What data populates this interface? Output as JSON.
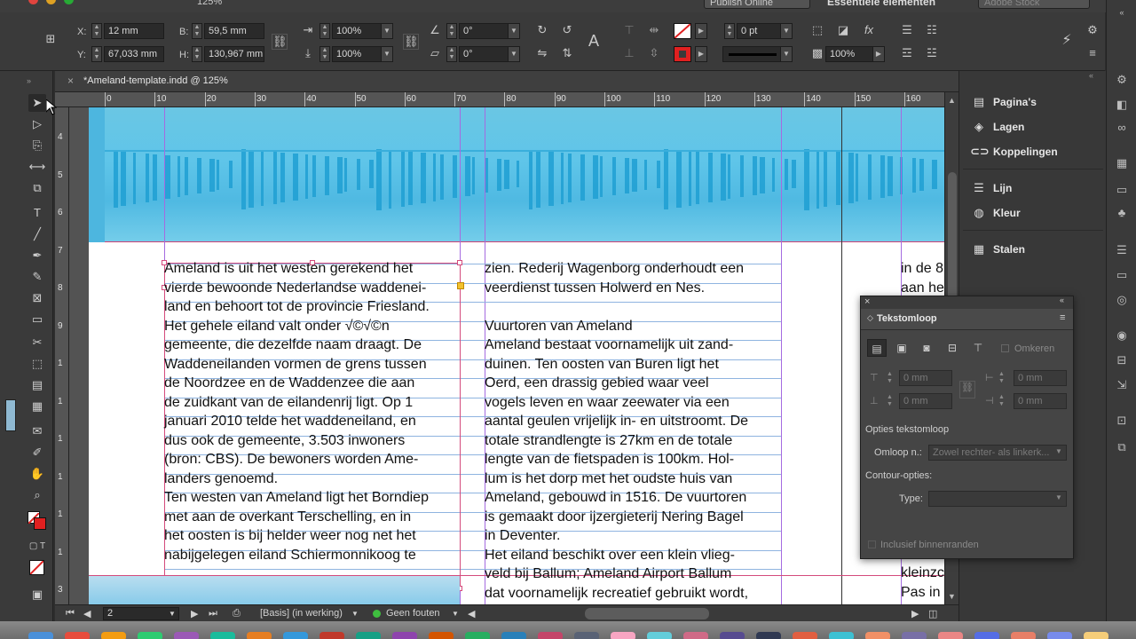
{
  "topbar": {
    "zoom": "125%",
    "publish_label": "Publish Online",
    "workspace_label": "Essentiële elementen",
    "search_placeholder": "Adobe Stock"
  },
  "control": {
    "x_label": "X:",
    "x_value": "12 mm",
    "y_label": "Y:",
    "y_value": "67,033 mm",
    "w_label": "B:",
    "w_value": "59,5 mm",
    "h_label": "H:",
    "h_value": "130,967 mm",
    "scale_x": "100%",
    "scale_y": "100%",
    "rotate": "0°",
    "shear": "0°",
    "stroke_weight": "0 pt",
    "opacity": "100%"
  },
  "tools": [
    "selection-tool",
    "direct-selection-tool",
    "page-tool",
    "gap-tool",
    "content-collector-tool",
    "type-tool",
    "line-tool",
    "pen-tool",
    "pencil-tool",
    "rectangle-frame-tool",
    "rectangle-tool",
    "scissors-tool",
    "free-transform-tool",
    "gradient-swatch-tool",
    "gradient-feather-tool",
    "note-tool",
    "eyedropper-tool",
    "hand-tool",
    "zoom-tool"
  ],
  "document": {
    "tab_title": "*Ameland-template.indd @ 125%",
    "ruler_h": [
      "0",
      "10",
      "20",
      "30",
      "40",
      "50",
      "60",
      "70",
      "80",
      "90",
      "100",
      "110",
      "120",
      "130",
      "140",
      "150",
      "160"
    ],
    "ruler_v": [
      "4",
      "5",
      "6",
      "7",
      "8",
      "9",
      "1",
      "1",
      "1",
      "1",
      "1",
      "1",
      "3"
    ],
    "col1": "Ameland is uit het westen gerekend het\nvierde bewoonde Nederlandse waddenei-\nland en behoort tot de provincie Friesland.\nHet gehele eiland valt onder √©√©n\ngemeente, die dezelfde naam draagt. De\nWaddeneilanden vormen de grens tussen\nde Noordzee en de Waddenzee die aan\nde zuidkant van de eilandenrij ligt. Op 1\njanuari 2010 telde het waddeneiland, en\ndus ook de gemeente, 3.503 inwoners\n(bron: CBS). De bewoners worden Ame-\nlanders genoemd.\nTen westen van Ameland ligt het Borndiep\nmet aan de overkant Terschelling, en in\nhet oosten is bij helder weer nog net het\nnabijgelegen eiland Schiermonnikoog te",
    "col2": "zien. Rederij Wagenborg onderhoudt een\nveerdienst tussen Holwerd en Nes.\n\nVuurtoren van Ameland\nAmeland bestaat voornamelijk uit zand-\nduinen. Ten oosten van Buren ligt het\nOerd, een drassig gebied waar veel\nvogels leven en waar zeewater via een\naantal geulen vrijelijk in- en uitstroomt. De\ntotale strandlengte is 27km en de totale\nlengte van de fietspaden is 100km. Hol-\nlum is het dorp met het oudste huis van\nAmeland, gebouwd in 1516. De vuurtoren\nis gemaakt door ijzergieterij Nering Bagel\nin Deventer.\nHet eiland beschikt over een klein vlieg-\nveld bij Ballum; Ameland Airport Ballum\ndat voornamelijk recreatief gebruikt wordt,",
    "col3_top": "in de 8\naan he",
    "col3_bottom": "kleinzc\nPas in"
  },
  "status": {
    "page_number": "2",
    "style": "[Basis] (in werking)",
    "preflight": "Geen fouten"
  },
  "panels": [
    {
      "icon": "pages-icon",
      "glyph": "▤",
      "label": "Pagina's"
    },
    {
      "icon": "layers-icon",
      "glyph": "◈",
      "label": "Lagen"
    },
    {
      "icon": "links-icon",
      "glyph": "⊂⊃",
      "label": "Koppelingen"
    },
    {
      "icon": "stroke-icon",
      "glyph": "☰",
      "label": "Lijn"
    },
    {
      "icon": "color-icon",
      "glyph": "◍",
      "label": "Kleur"
    },
    {
      "icon": "swatches-icon",
      "glyph": "▦",
      "label": "Stalen"
    }
  ],
  "textwrap": {
    "title": "Tekstomloop",
    "invert_label": "Omkeren",
    "top_offset": "0 mm",
    "bottom_offset": "0 mm",
    "left_offset": "0 mm",
    "right_offset": "0 mm",
    "options_title": "Opties tekstomloop",
    "wrap_to_label": "Omloop n.:",
    "wrap_to_value": "Zowel rechter- als linkerk...",
    "contour_title": "Contour-opties:",
    "type_label": "Type:",
    "include_inside_label": "Inclusief binnenranden"
  },
  "colors": {
    "frame": "#d44b7c",
    "guide": "#a56be0",
    "photo": "#5fc5e9",
    "baseline": "#8fb4e0"
  }
}
